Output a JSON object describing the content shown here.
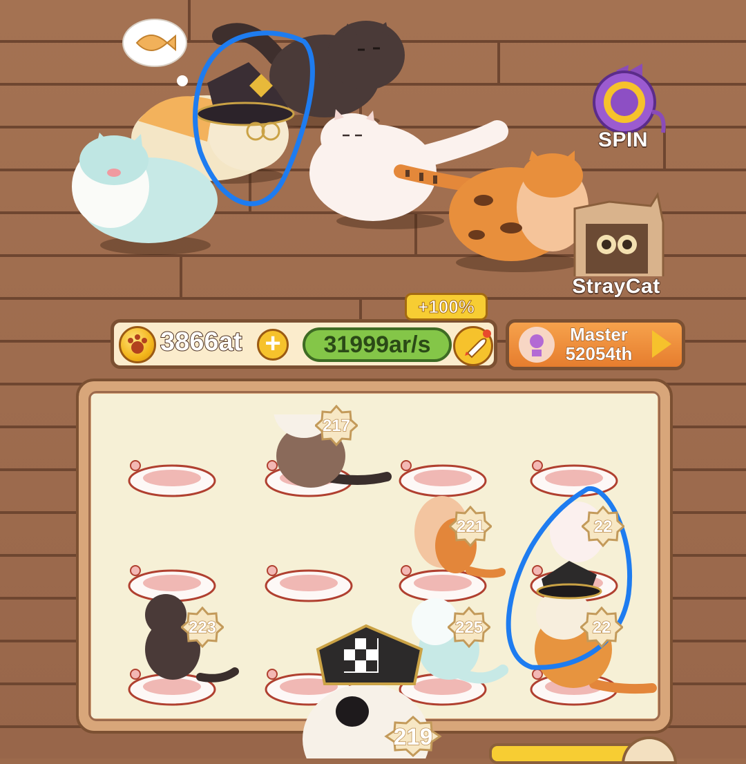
{
  "spin": {
    "label": "SPIN"
  },
  "stray": {
    "label": "StrayCat"
  },
  "hud": {
    "coins": "3866at",
    "plus": "+",
    "rate": "31999ar/s",
    "boost": "+100%",
    "rank_title": "Master",
    "rank_value": "52054th"
  },
  "board": {
    "levels": [
      "217",
      "221",
      "22",
      "223",
      "225",
      "22",
      "219"
    ]
  },
  "colors": {
    "floor": "#a47252",
    "board_bg": "#f6f0d6",
    "annotation_blue": "#1e7cf0",
    "rate_green": "#84c648",
    "rank_orange": "#e67d2e"
  },
  "icons": [
    "fish-thought-icon",
    "spin-wheel-icon",
    "stray-cat-box-icon",
    "paw-coin-icon",
    "plus-icon",
    "rocket-icon",
    "trophy-icon",
    "play-arrow-icon"
  ]
}
